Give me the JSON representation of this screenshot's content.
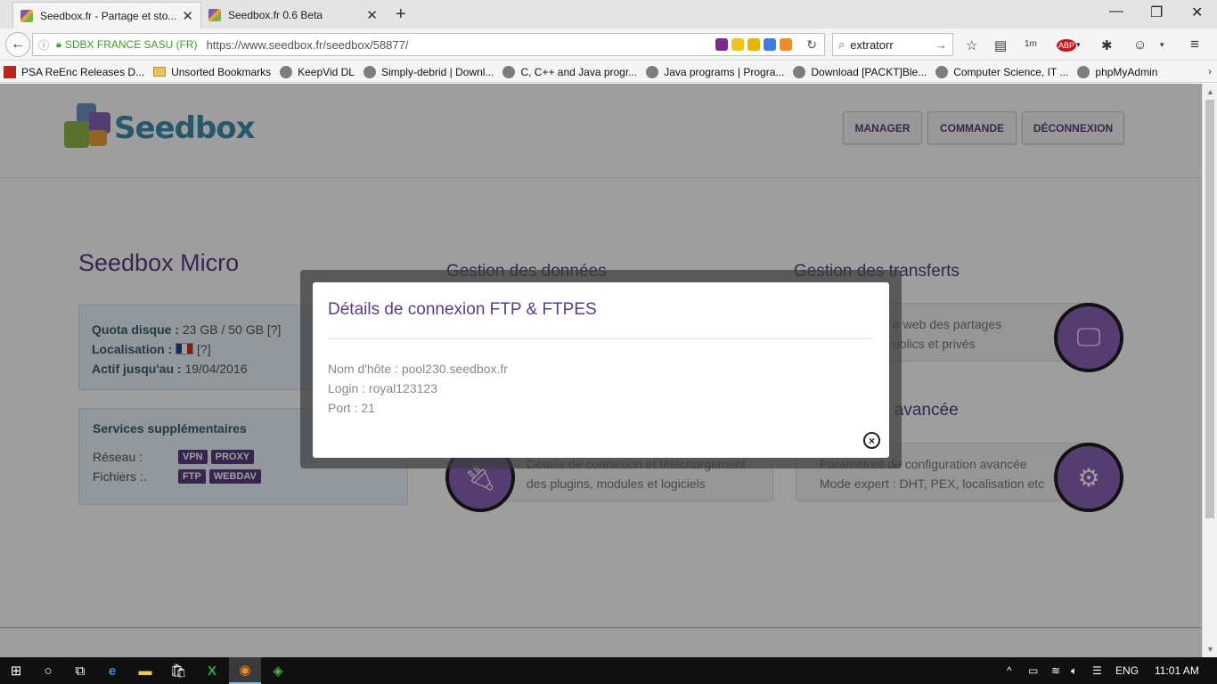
{
  "browser": {
    "tabs": [
      {
        "title": "Seedbox.fr - Partage et sto...",
        "active": true
      },
      {
        "title": "Seedbox.fr 0.6 Beta",
        "active": false
      }
    ],
    "site_identity": "SDBX FRANCE SASU (FR)",
    "url": "https://www.seedbox.fr/seedbox/58877/",
    "search_value": "extratorr",
    "bookmarks": [
      {
        "label": "PSA ReEnc Releases D...",
        "icon": "psa-icon"
      },
      {
        "label": "Unsorted Bookmarks",
        "icon": "folder-icon"
      },
      {
        "label": "KeepVid DL",
        "icon": "globe-icon"
      },
      {
        "label": "Simply-debrid | Downl...",
        "icon": "globe-icon"
      },
      {
        "label": "C, C++ and Java progr...",
        "icon": "globe-icon"
      },
      {
        "label": "Java programs | Progra...",
        "icon": "globe-icon"
      },
      {
        "label": "Download [PACKT]Ble...",
        "icon": "globe-icon"
      },
      {
        "label": "Computer Science, IT ...",
        "icon": "globe-icon"
      },
      {
        "label": "phpMyAdmin",
        "icon": "globe-icon"
      }
    ]
  },
  "header": {
    "logo_text": "Seedbox",
    "nav": [
      "MANAGER",
      "COMMANDE",
      "DÉCONNEXION"
    ]
  },
  "plan": {
    "title": "Seedbox Micro",
    "quota_label": "Quota disque :",
    "quota_value": "23 GB / 50 GB",
    "help": "[?]",
    "location_label": "Localisation :",
    "active_label": "Actif jusqu'au :",
    "active_value": "19/04/2016"
  },
  "services": {
    "title": "Services supplémentaires",
    "network_label": "Réseau :",
    "network_badges": [
      "VPN",
      "PROXY"
    ],
    "files_label": "Fichiers :.",
    "files_badges": [
      "FTP",
      "WEBDAV"
    ]
  },
  "sections": {
    "data_title": "Gestion des données",
    "transfers_title": "Gestion des transferts",
    "share_line1": "e web des partages",
    "share_line2": "ublics et privés",
    "advanced_title": "n avancée",
    "plugins_line1": "Détails de connexion et téléchargement",
    "plugins_line2": "des plugins, modules et logiciels",
    "config_line1": "Paramètres de configuration avancée",
    "config_line2": "Mode expert : DHT, PEX, localisation etc"
  },
  "modal": {
    "title": "Détails de connexion FTP & FTPES",
    "hostname": "Nom d'hôte : pool230.seedbox.fr",
    "login": "Login : royal123123",
    "port": "Port : 21",
    "close_symbol": "×"
  },
  "taskbar": {
    "language": "ENG",
    "time": "11:01 AM"
  },
  "colors": {
    "brand_purple": "#5a3d80",
    "circle_purple": "#8a63b8",
    "secure_green": "#3a9a2c"
  }
}
